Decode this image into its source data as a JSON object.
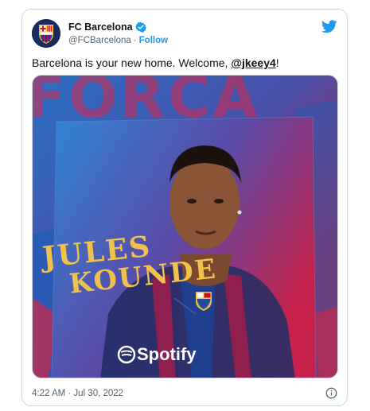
{
  "tweet": {
    "author": {
      "display_name": "FC Barcelona",
      "handle": "@FCBarcelona",
      "separator": "·",
      "follow_label": "Follow",
      "avatar_icon": "fc-barcelona-crest"
    },
    "text_prefix": "Barcelona is your new home. Welcome, ",
    "mention": "@jkeey4",
    "text_suffix": "!",
    "timestamp": "4:22 AM · Jul 30, 2022"
  },
  "media": {
    "background_word": "FORÇA",
    "player_name_line1": "JULES",
    "player_name_line2": "KOUNDE",
    "sponsor": "Spotify"
  },
  "icons": {
    "verified": "verified-badge-icon",
    "brand": "twitter-bird-icon",
    "info": "info-icon"
  },
  "colors": {
    "link_blue": "#1d9bf0",
    "text": "#0f1419",
    "secondary_text": "#536471",
    "border": "#cfd9de",
    "barca_blue": "#1e4e9c",
    "barca_red": "#a50044",
    "name_gold": "#f1c24b"
  }
}
